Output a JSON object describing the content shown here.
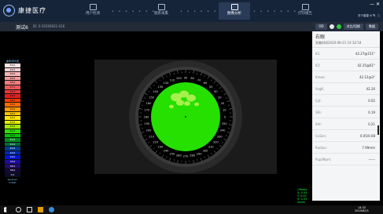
{
  "app": {
    "name": "康捷医疗"
  },
  "nav": [
    {
      "label": "用户检测",
      "active": false
    },
    {
      "label": "图形采集",
      "active": false
    },
    {
      "label": "图像分析",
      "active": true
    },
    {
      "label": "打印报告",
      "active": false
    }
  ],
  "window_controls": "— ✕",
  "header_meta": "关于康捷  ⚙ 🔍 ▢",
  "patient": {
    "name": "测试6",
    "id": "ID: 0-20200621-016"
  },
  "toolbar": {
    "btn_left": "OD",
    "btn_right_a": "对比/切换",
    "btn_right_b": "数据"
  },
  "scale": {
    "title": "曲率/屈光度",
    "entries": [
      {
        "label": "50.0",
        "color": "#f6e3e3"
      },
      {
        "label": "49.5",
        "color": "#f6cfd1"
      },
      {
        "label": "49.0",
        "color": "#f4b4b6"
      },
      {
        "label": "48.5",
        "color": "#f39a9c"
      },
      {
        "label": "48.0",
        "color": "#f07d7e"
      },
      {
        "label": "47.5",
        "color": "#ef5b5d"
      },
      {
        "label": "47.0",
        "color": "#e93739"
      },
      {
        "label": "46.5",
        "color": "#e21e21"
      },
      {
        "label": "46.0",
        "color": "#ff3b00"
      },
      {
        "label": "45.5",
        "color": "#ff6a00"
      },
      {
        "label": "45.0",
        "color": "#ff9a00"
      },
      {
        "label": "44.5",
        "color": "#ffc300"
      },
      {
        "label": "44.0",
        "color": "#ffe600"
      },
      {
        "label": "43.5",
        "color": "#e6f000"
      },
      {
        "label": "43.0",
        "color": "#a6e800"
      },
      {
        "label": "42.5",
        "color": "#2fdc00"
      },
      {
        "label": "42.0",
        "color": "#00c800"
      },
      {
        "label": "41.5",
        "color": "#008a1e"
      },
      {
        "label": "41.0",
        "color": "#00683c"
      },
      {
        "label": "40.5",
        "color": "#003c8c"
      },
      {
        "label": "40.0",
        "color": "#0028b4"
      },
      {
        "label": "39.5",
        "color": "#0014d2"
      },
      {
        "label": "39.0",
        "color": "#1e0aa0"
      },
      {
        "label": "38.5",
        "color": "#230a6e"
      },
      {
        "label": "38.0",
        "color": "#14083c"
      },
      {
        "label": "0.5",
        "color": "#0a0a28"
      }
    ],
    "foot": "Keratom\n0.50D"
  },
  "map": {
    "ring_labels": [
      "0",
      "10",
      "20",
      "30",
      "40",
      "50",
      "60",
      "70",
      "80",
      "90",
      "100",
      "110",
      "120",
      "130",
      "140",
      "150",
      "160",
      "170",
      "180",
      "190",
      "200",
      "210",
      "220",
      "230",
      "240",
      "250",
      "260",
      "270",
      "280",
      "290",
      "300",
      "310",
      "320",
      "330",
      "340",
      "350"
    ],
    "colors": {
      "main": "#25e000",
      "highlight": "#bcf25a",
      "ring": "#000",
      "bg": "#1b1b1b"
    }
  },
  "panel": {
    "title": "右眼",
    "date": "采集时间2020-06-21 14:32:54",
    "rows": [
      {
        "k": "K1:",
        "v": "42.27@151°"
      },
      {
        "k": "K2:",
        "v": "42.25@61°"
      },
      {
        "k": "Kmea:",
        "v": "42.12@3°"
      },
      {
        "k": "AvgK:",
        "v": "42.26"
      },
      {
        "k": "Cyl:",
        "v": "0.02"
      },
      {
        "k": "SRI:",
        "v": "0.19"
      },
      {
        "k": "SAI:",
        "v": "0.21"
      },
      {
        "k": "CuSim:",
        "v": "0.05/0.08"
      },
      {
        "k": "Radius:",
        "v": "7.99mm"
      },
      {
        "k": "PupilNum:",
        "v": "------"
      }
    ]
  },
  "legend": [
    "Offsets",
    "X: 0.09",
    "Y: 0.00",
    "0: 0.05",
    "Zoom"
  ],
  "taskbar": {
    "time": "14:32",
    "date": "2020/6/21"
  }
}
